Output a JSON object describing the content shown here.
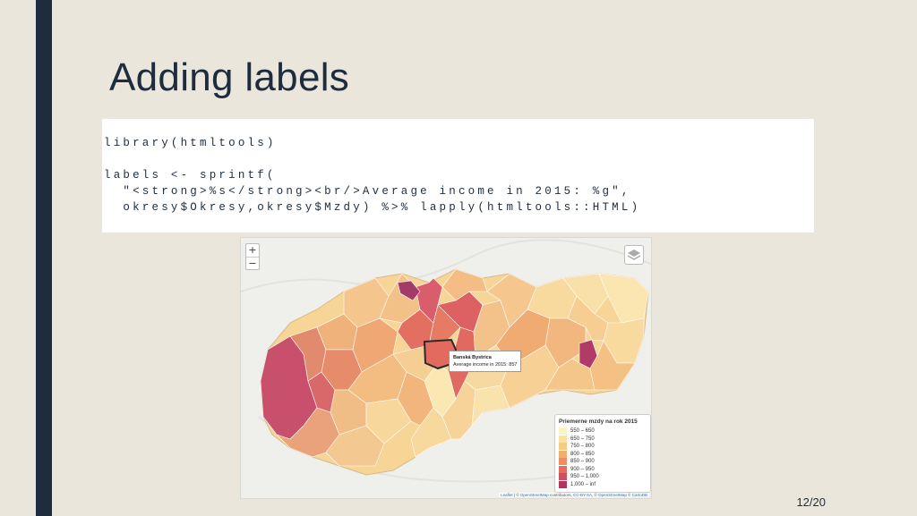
{
  "slide": {
    "title": "Adding labels",
    "page_number": "12/20"
  },
  "code": {
    "text": "library(htmltools)\n\nlabels <- sprintf(\n  \"<strong>%s</strong><br/>Average income in 2015: %g\",\n  okresy$Okresy,okresy$Mzdy) %>% lapply(htmltools::HTML)"
  },
  "map": {
    "zoom_in": "+",
    "zoom_out": "−",
    "tooltip": {
      "name": "Banská Bystrica",
      "value": "Average income in 2015: 857"
    },
    "legend": {
      "title": "Priemerne mzdy na rok 2015",
      "items": [
        {
          "label": "550 – 650",
          "color": "#fdf2c4"
        },
        {
          "label": "650 – 750",
          "color": "#fbe2a0"
        },
        {
          "label": "750 – 800",
          "color": "#f8ca82"
        },
        {
          "label": "800 – 850",
          "color": "#f2ae6e"
        },
        {
          "label": "850 – 900",
          "color": "#eb8e62"
        },
        {
          "label": "900 – 950",
          "color": "#e06d5e"
        },
        {
          "label": "950 – 1,000",
          "color": "#cf4f61"
        },
        {
          "label": "1,000 – inf",
          "color": "#b03460"
        }
      ]
    },
    "attribution": {
      "leaflet": "Leaflet",
      "sep1": " | © ",
      "osm1": "OpenStreetMap",
      "text1": " contributors, ",
      "license": "CC-BY-SA",
      "sep2": ", © ",
      "osm2": "OpenStreetMap",
      "sep3": " © ",
      "carto": "CartoDB"
    }
  }
}
